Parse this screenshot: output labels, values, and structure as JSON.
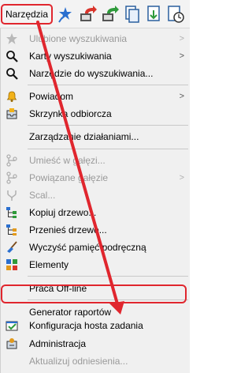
{
  "menu_title": "Narzędzia",
  "toolbar_icons": [
    "star-pin-icon",
    "red-export-icon",
    "green-import-icon",
    "document-copy-icon",
    "document-download-icon",
    "clock-settings-icon"
  ],
  "items": [
    {
      "label": "Ulubione wyszukiwania",
      "icon": "star-icon",
      "disabled": true,
      "submenu": true
    },
    {
      "label": "Karty wyszukiwania",
      "icon": "search-icon",
      "disabled": false,
      "submenu": true
    },
    {
      "label": "Narzędzie do wyszukiwania...",
      "icon": "search-icon",
      "disabled": false,
      "submenu": false
    },
    {
      "label": "Powiadom",
      "icon": "bell-icon",
      "disabled": false,
      "submenu": true
    },
    {
      "label": "Skrzynka odbiorcza",
      "icon": "inbox-icon",
      "disabled": false,
      "submenu": false
    },
    {
      "label": "Zarządzanie działaniami...",
      "icon": "",
      "disabled": false,
      "submenu": false
    },
    {
      "label": "Umieść w gałęzi...",
      "icon": "branch-icon",
      "disabled": true,
      "submenu": false
    },
    {
      "label": "Powiązane gałęzie",
      "icon": "branch-icon",
      "disabled": true,
      "submenu": true
    },
    {
      "label": "Scal...",
      "icon": "merge-icon",
      "disabled": true,
      "submenu": false
    },
    {
      "label": "Kopiuj drzewo...",
      "icon": "tree-copy-icon",
      "disabled": false,
      "submenu": false
    },
    {
      "label": "Przenieś drzewo...",
      "icon": "tree-move-icon",
      "disabled": false,
      "submenu": false
    },
    {
      "label": "Wyczyść pamięć podręczną",
      "icon": "broom-icon",
      "disabled": false,
      "submenu": false
    },
    {
      "label": "Elementy",
      "icon": "elements-icon",
      "disabled": false,
      "submenu": false
    },
    {
      "label": "Praca Off-line",
      "icon": "",
      "disabled": false,
      "submenu": false
    },
    {
      "label": "Generator raportów",
      "icon": "",
      "disabled": false,
      "submenu": false
    },
    {
      "label": "Konfiguracja hosta zadania",
      "icon": "check-window-icon",
      "disabled": false,
      "submenu": false
    },
    {
      "label": "Administracja",
      "icon": "admin-icon",
      "disabled": false,
      "submenu": false
    },
    {
      "label": "Aktualizuj odniesienia...",
      "icon": "",
      "disabled": true,
      "submenu": false
    }
  ],
  "submenu_glyph": ">",
  "colors": {
    "highlight": "#e0262e",
    "disabled_text": "#9a9a9a",
    "menu_bg": "#f0f0f0"
  }
}
